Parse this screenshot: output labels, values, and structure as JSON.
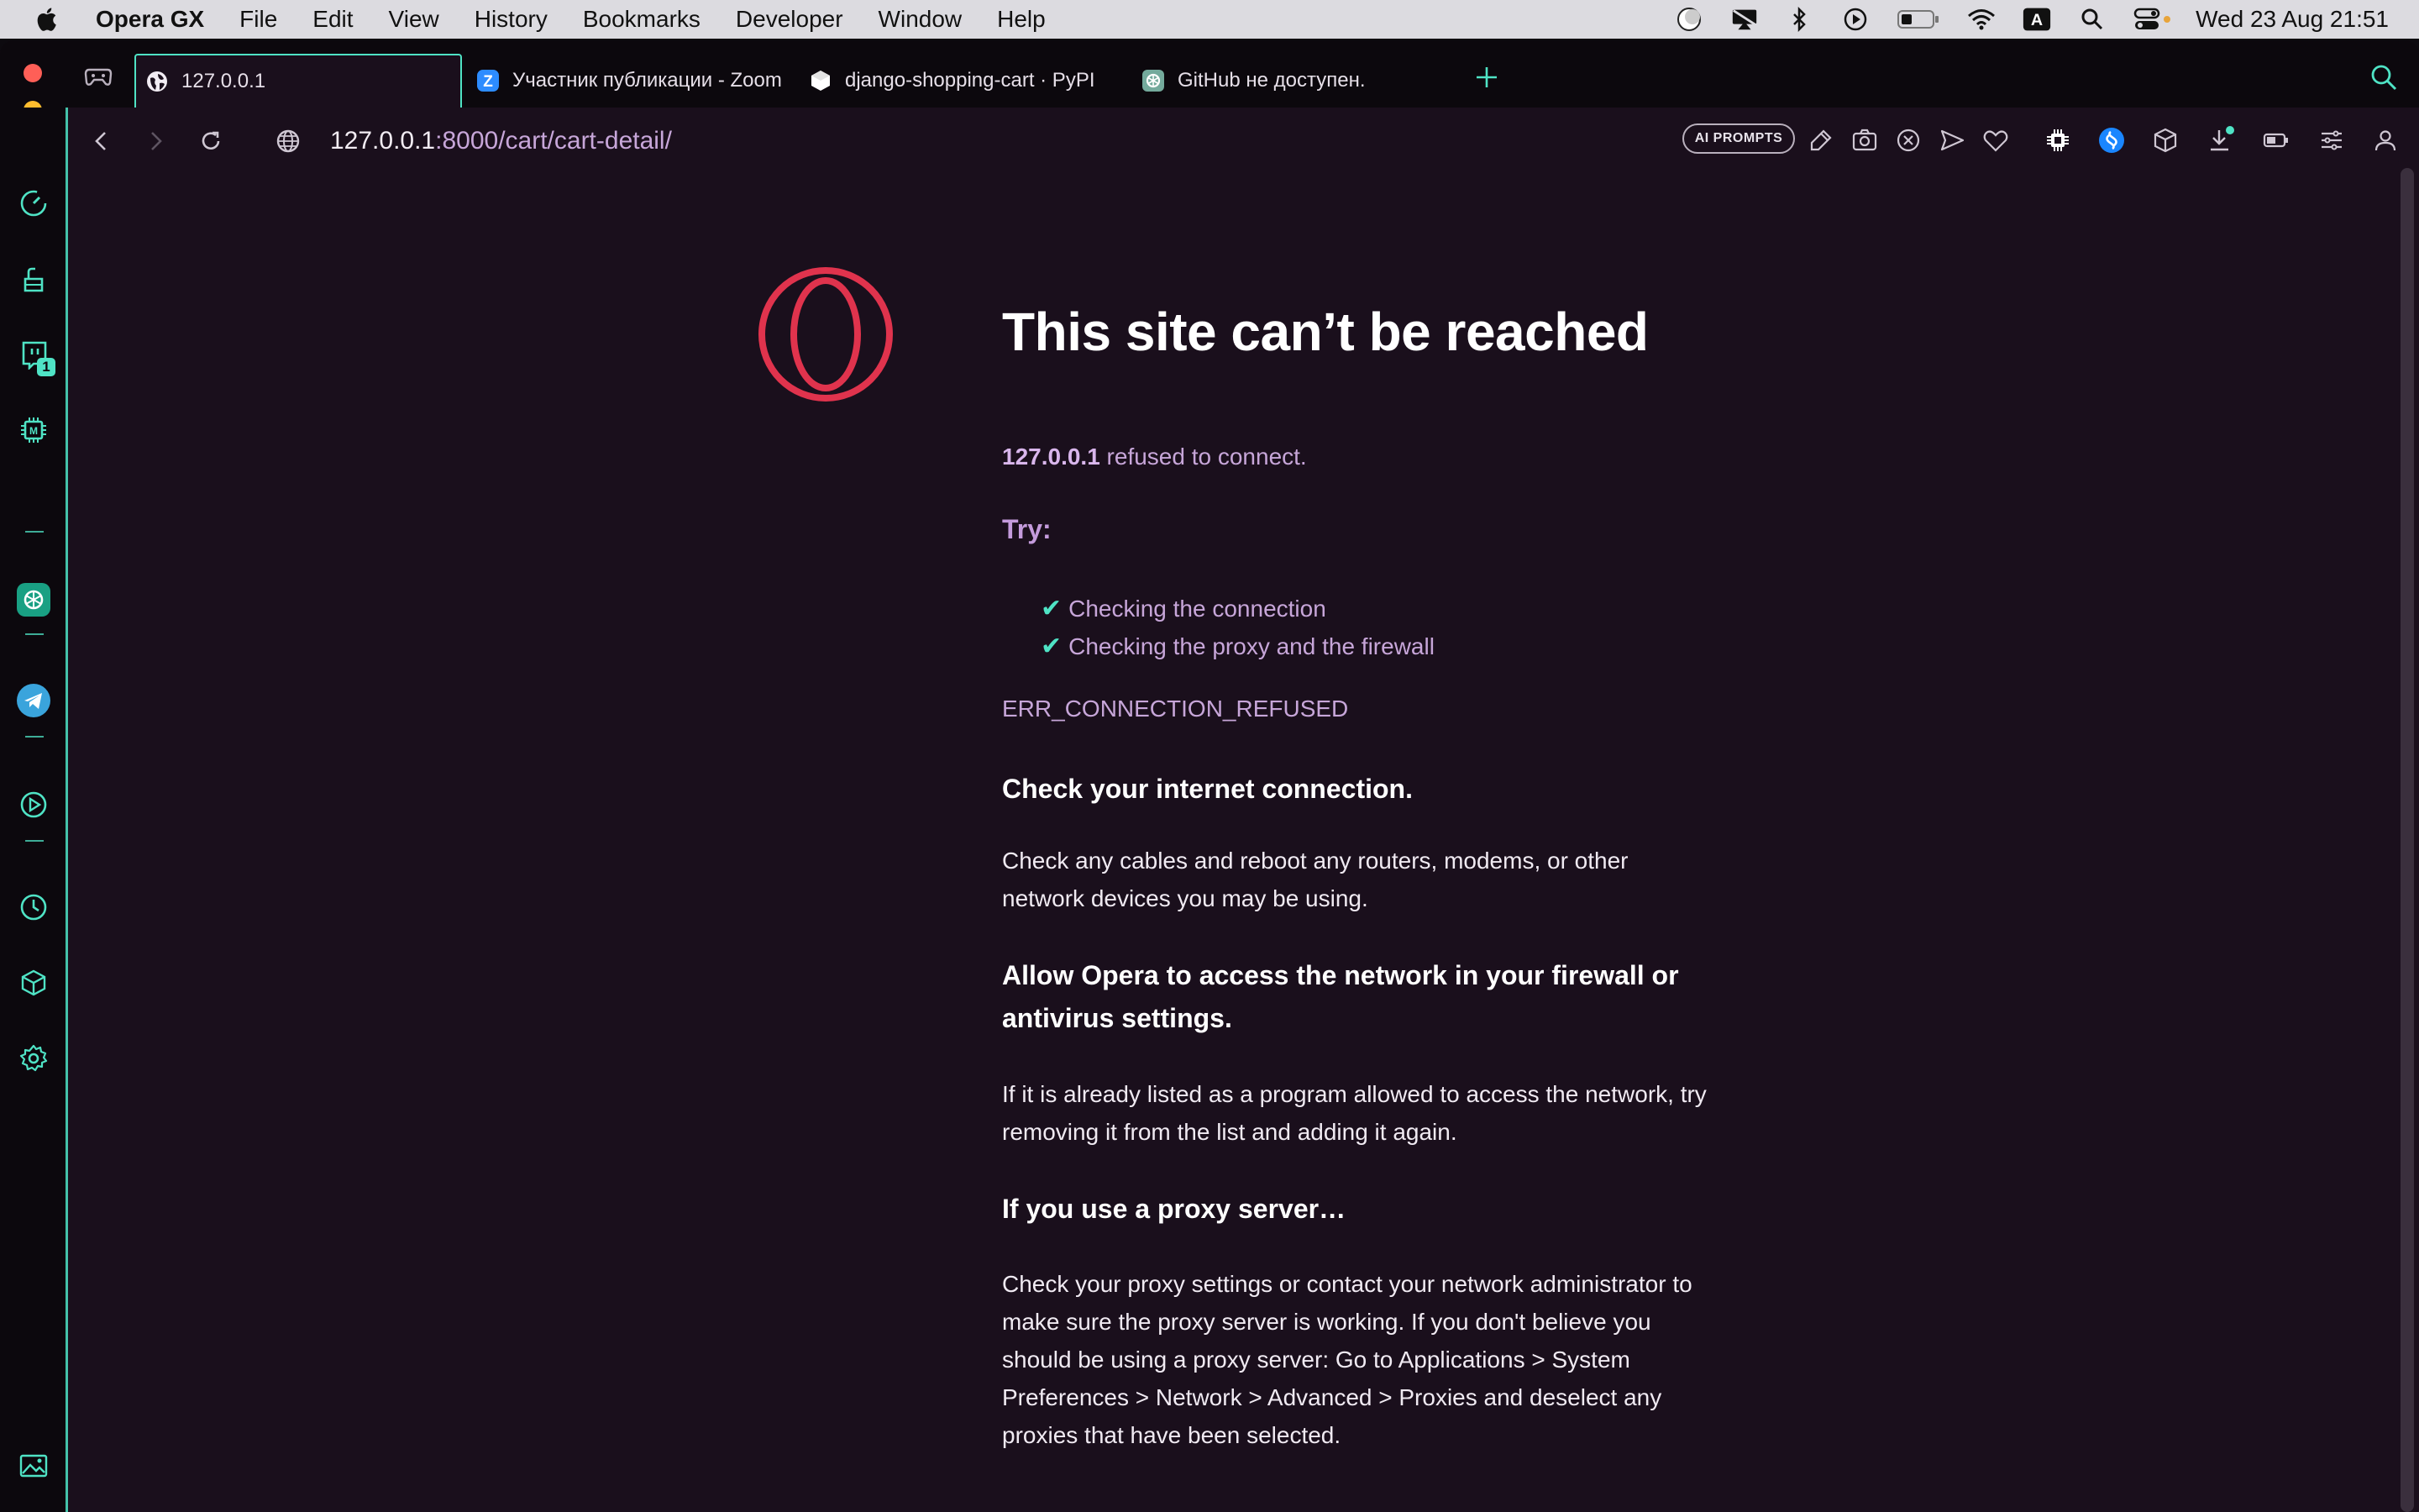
{
  "menubar": {
    "app_name": "Opera GX",
    "items": [
      "File",
      "Edit",
      "View",
      "History",
      "Bookmarks",
      "Developer",
      "Window",
      "Help"
    ],
    "clock": "Wed 23 Aug  21:51",
    "status_icons": [
      "vpn-icon",
      "display-icon",
      "bluetooth-icon",
      "play-icon",
      "battery-icon",
      "wifi-icon",
      "input-source-icon",
      "spotlight-icon",
      "control-center-icon"
    ],
    "input_source": "A"
  },
  "tabs": [
    {
      "title": "127.0.0.1",
      "favicon": "globe-icon",
      "active": true
    },
    {
      "title": "Участник публикации - Zoom",
      "favicon": "zoom-icon",
      "active": false
    },
    {
      "title": "django-shopping-cart · PyPI",
      "favicon": "pypi-icon",
      "active": false
    },
    {
      "title": "GitHub не доступен.",
      "favicon": "chatgpt-icon",
      "active": false
    }
  ],
  "address": {
    "host": "127.0.0.1",
    "path": ":8000/cart/cart-detail/"
  },
  "toolbar": {
    "ai_prompts_label": "AI PROMPTS"
  },
  "sidebar": {
    "twitch_badge": "1"
  },
  "error_page": {
    "title": "This site can’t be reached",
    "host": "127.0.0.1",
    "refused_text": " refused to connect.",
    "try_label": "Try:",
    "suggestions": [
      "Checking the connection",
      "Checking the proxy and the firewall"
    ],
    "error_code": "ERR_CONNECTION_REFUSED",
    "sections": [
      {
        "heading": "Check your internet connection.",
        "body": "Check any cables and reboot any routers, modems, or other network devices you may be using."
      },
      {
        "heading": "Allow Opera to access the network in your firewall or antivirus settings.",
        "body": "If it is already listed as a program allowed to access the network, try removing it from the list and adding it again."
      },
      {
        "heading": "If you use a proxy server…",
        "body": "Check your proxy settings or contact your network administrator to make sure the proxy server is working. If you don't believe you should be using a proxy server: Go to Applications > System Preferences > Network > Advanced > Proxies and deselect any proxies that have been selected."
      }
    ]
  },
  "colors": {
    "accent": "#4fe3c5",
    "background": "#1a0f1c",
    "opera_red": "#e0334d",
    "lilac": "#c7a6d9"
  }
}
